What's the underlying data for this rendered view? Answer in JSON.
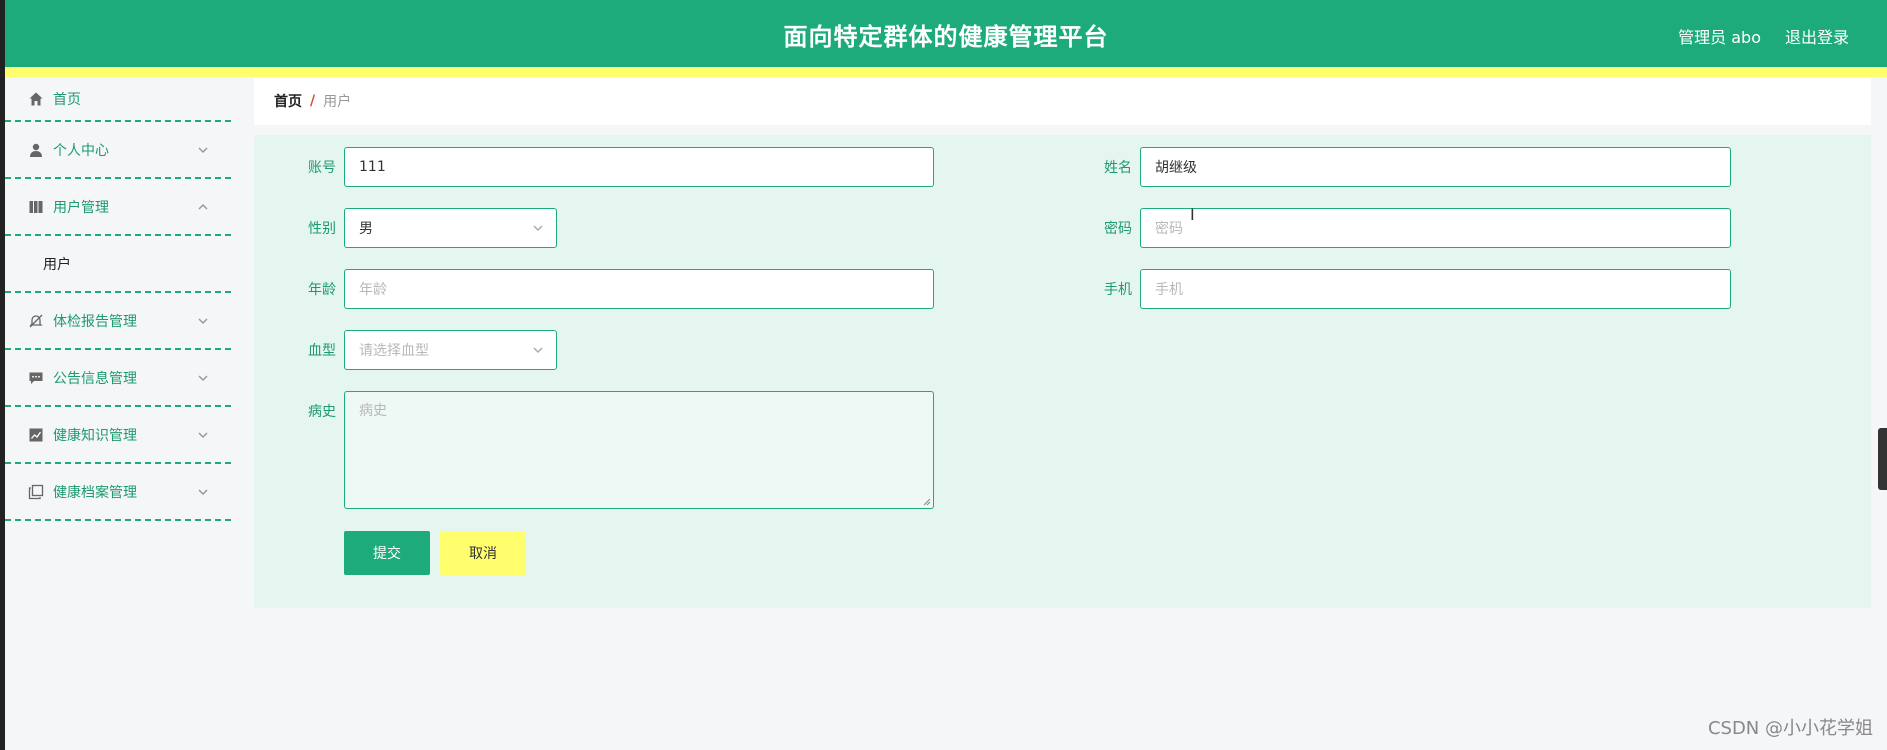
{
  "header": {
    "title": "面向特定群体的健康管理平台",
    "user": "管理员 abo",
    "logout": "退出登录"
  },
  "sidebar": {
    "items": [
      {
        "label": "首页",
        "icon": "home-icon"
      },
      {
        "label": "个人中心",
        "icon": "user-icon",
        "expanded": false
      },
      {
        "label": "用户管理",
        "icon": "book-icon",
        "expanded": true
      },
      {
        "label": "体检报告管理",
        "icon": "bell-off-icon",
        "expanded": false
      },
      {
        "label": "公告信息管理",
        "icon": "chat-icon",
        "expanded": false
      },
      {
        "label": "健康知识管理",
        "icon": "chart-icon",
        "expanded": false
      },
      {
        "label": "健康档案管理",
        "icon": "copy-icon",
        "expanded": false
      }
    ],
    "submenu": {
      "label": "用户"
    }
  },
  "breadcrumb": {
    "home": "首页",
    "separator": "/",
    "current": "用户"
  },
  "form": {
    "account": {
      "label": "账号",
      "value": "111"
    },
    "name": {
      "label": "姓名",
      "value": "胡继级"
    },
    "gender": {
      "label": "性别",
      "value": "男"
    },
    "password": {
      "label": "密码",
      "placeholder": "密码"
    },
    "age": {
      "label": "年龄",
      "placeholder": "年龄"
    },
    "phone": {
      "label": "手机",
      "placeholder": "手机"
    },
    "blood": {
      "label": "血型",
      "placeholder": "请选择血型"
    },
    "history": {
      "label": "病史",
      "placeholder": "病史"
    },
    "submit": "提交",
    "cancel": "取消"
  },
  "watermark": "CSDN @小小花学姐",
  "colors": {
    "primary": "#1dab7b",
    "accent_yellow": "#ffff6e",
    "form_bg": "#e5f5ef"
  }
}
